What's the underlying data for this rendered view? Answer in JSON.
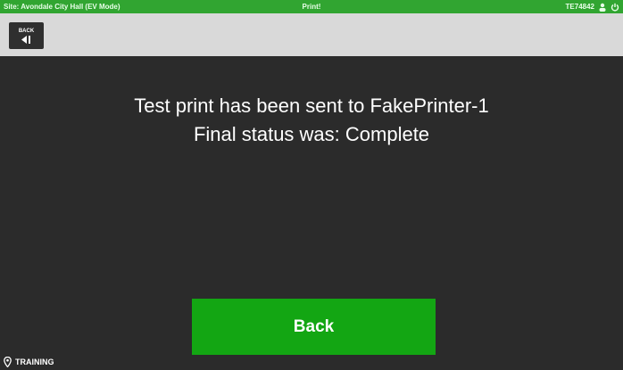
{
  "status_bar": {
    "site": "Site: Avondale City Hall (EV Mode)",
    "title": "Print!",
    "device_id": "TE74842",
    "color": "#31a531"
  },
  "toolbar": {
    "back_mini_label": "BACK",
    "back_mini_icon": "back-arrow-icon"
  },
  "message": {
    "line1": "Test print has been sent to FakePrinter-1",
    "line2": "Final status was: Complete"
  },
  "back_button": {
    "label": "Back",
    "color": "#13a613"
  },
  "footer": {
    "training_label": "TRAINING",
    "icon": "location-pin-icon"
  }
}
